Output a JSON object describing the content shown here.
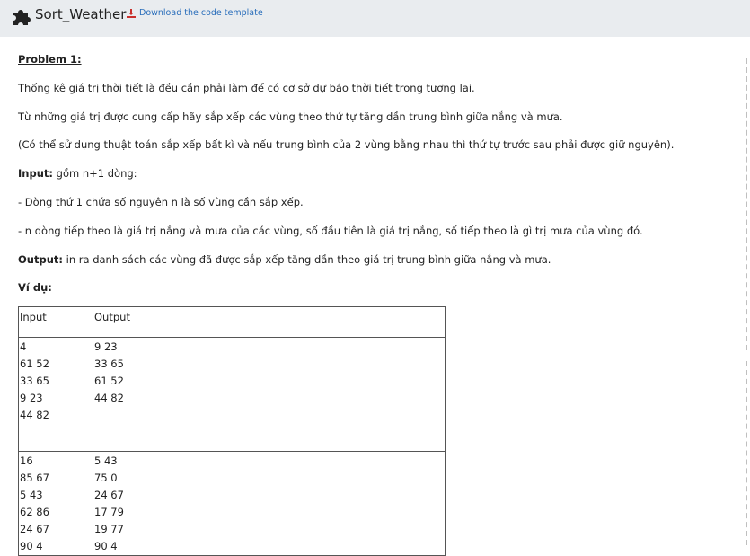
{
  "header": {
    "title": "Sort_Weather",
    "download_label": "Download the code template"
  },
  "problem": {
    "heading": "Problem 1:",
    "line1": "Thống kê giá trị thời tiết là đều cần phải làm để có cơ sở dự báo thời tiết trong tương lai.",
    "line2": "Từ những giá trị được cung cấp hãy sắp xếp các vùng theo thứ tự tăng dần trung bình giữa nắng và mưa.",
    "line3": "(Có thể sử dụng thuật toán sắp xếp bất kì và nếu trung bình của 2 vùng bằng nhau thì thứ tự trước sau phải được giữ nguyên).",
    "input_label": "Input:",
    "input_text": " gồm n+1 dòng:",
    "input_line1": "- Dòng thứ 1 chứa số nguyên n là số vùng cần sắp xếp.",
    "input_line2": "- n dòng tiếp theo là giá trị nắng và mưa của các vùng, số đầu tiên là giá trị nắng, số tiếp theo là gì trị mưa của vùng đó.",
    "output_label": "Output:",
    "output_text": " in ra danh sách các vùng đã được sắp xếp tăng dần theo giá trị trung bình giữa nắng và mưa.",
    "example_label": "Ví dụ:"
  },
  "table": {
    "headers": [
      "Input",
      "Output"
    ],
    "rows": [
      {
        "input": "4\n61 52\n33 65\n9 23\n44 82",
        "output": "9 23\n33 65\n61 52\n44 82"
      },
      {
        "input": "16\n85 67\n5 43\n62 86\n24 67\n90 4",
        "output": "5 43\n75 0\n24 67\n17 79\n19 77\n90 4"
      }
    ]
  },
  "colors": {
    "topbar": "#e9ecef",
    "link": "#2a6ebb",
    "download_icon": "#c9302c"
  },
  "icons": [
    "puzzle-icon",
    "download-icon"
  ]
}
